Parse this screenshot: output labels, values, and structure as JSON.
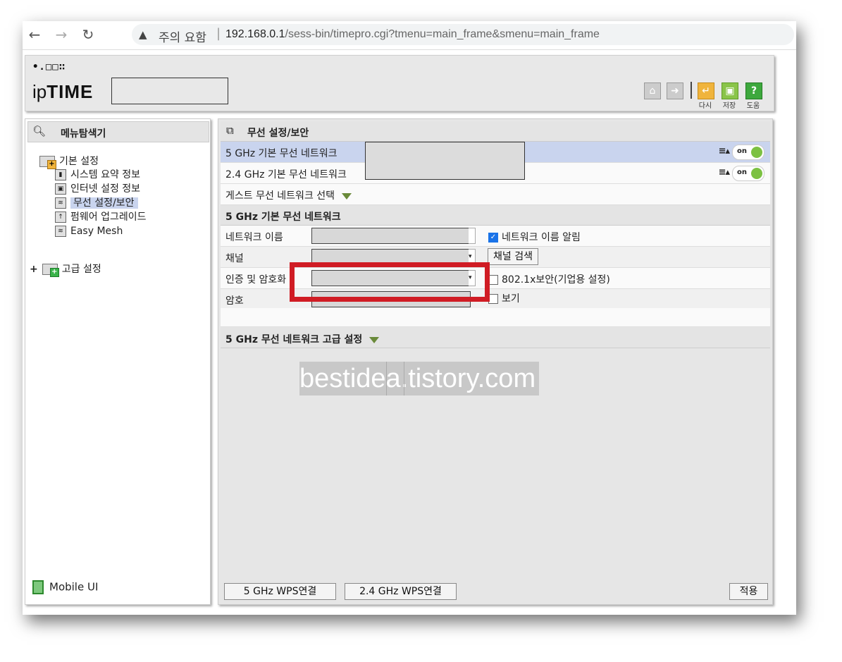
{
  "browser": {
    "warning": "주의 요함",
    "separator": "|",
    "url_host": "192.168.0.1",
    "url_path": "/sess-bin/timepro.cgi?tmenu=main_frame&smenu=main_frame"
  },
  "header": {
    "logo_dots": "•.□□∷",
    "logo_ip": "ip",
    "logo_time": "TIME",
    "buttons": [
      {
        "icon": "home-icon",
        "label": ""
      },
      {
        "icon": "logout-icon",
        "label": ""
      },
      {
        "icon": "restart-icon",
        "label": "다시"
      },
      {
        "icon": "save-icon",
        "label": "저장"
      },
      {
        "icon": "help-icon",
        "label": "도움"
      }
    ],
    "help_glyph": "?"
  },
  "sidebar": {
    "title": "메뉴탐색기",
    "basic_settings": "기본 설정",
    "items": [
      {
        "label": "시스템 요약 정보",
        "icon": "chart-icon"
      },
      {
        "label": "인터넷 설정 정보",
        "icon": "network-icon"
      },
      {
        "label": "무선 설정/보안",
        "icon": "wireless-icon",
        "selected": true
      },
      {
        "label": "펌웨어 업그레이드",
        "icon": "upgrade-icon"
      },
      {
        "label": "Easy Mesh",
        "icon": "wireless-icon"
      }
    ],
    "advanced_settings": "고급 설정",
    "advanced_expander": "+",
    "mobile_ui": "Mobile UI"
  },
  "main": {
    "title": "무선 설정/보안",
    "networks": [
      {
        "label": "5 GHz 기본 무선 네트워크",
        "toggle": "on"
      },
      {
        "label": "2.4 GHz 기본 무선 네트워크",
        "toggle": "on"
      }
    ],
    "guest_select": "게스트 무선 네트워크 선택",
    "section_5ghz": "5 GHz 기본 무선 네트워크",
    "form": {
      "network_name_label": "네트워크 이름",
      "network_name_broadcast": "네트워크 이름 알림",
      "channel_label": "채널",
      "channel_search": "채널 검색",
      "auth_label": "인증 및 암호화",
      "auth_8021x": "802.1x보안(기업용 설정)",
      "password_label": "암호",
      "show_password": "보기"
    },
    "advanced_section": "5 GHz 무선 네트워크 고급 설정",
    "buttons": {
      "wps_5": "5 GHz WPS연결",
      "wps_24": "2.4 GHz WPS연결",
      "apply": "적용"
    }
  },
  "watermark": "bestidea.tistory.com",
  "colors": {
    "highlight_red": "#d01c24",
    "selected_row": "#c9d4ee",
    "toggle_on": "#7cc142"
  }
}
